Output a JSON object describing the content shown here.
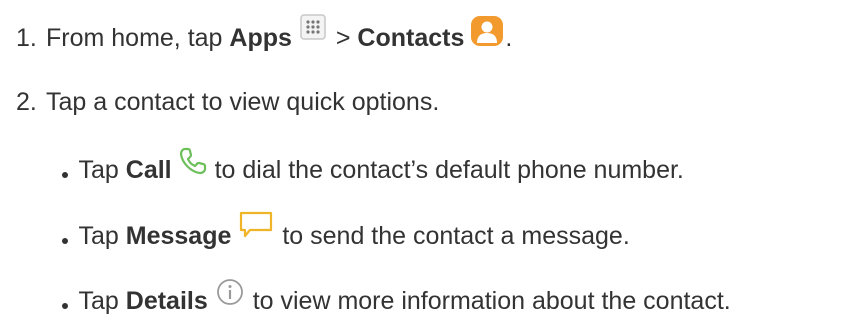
{
  "steps": [
    {
      "number": "1.",
      "pre": "From home, tap ",
      "bold1": "Apps",
      "mid": " > ",
      "bold2": "Contacts",
      "post": ".",
      "icon1": "apps-grid-icon",
      "icon2": "contacts-app-icon"
    },
    {
      "number": "2.",
      "text": "Tap a contact to view quick options."
    }
  ],
  "bullets": [
    {
      "pre": "Tap ",
      "bold": "Call",
      "post": " to dial the contact’s default phone number.",
      "icon": "phone-call-icon",
      "icon_color": "#6cbf5a"
    },
    {
      "pre": "Tap ",
      "bold": "Message",
      "post": " to send the contact a message.",
      "icon": "message-bubble-icon",
      "icon_color": "#f0b429"
    },
    {
      "pre": "Tap ",
      "bold": "Details",
      "post": " to view more information about the contact.",
      "icon": "info-circle-icon",
      "icon_color": "#9a9a9a"
    }
  ],
  "colors": {
    "text": "#333333",
    "contacts_icon": "#f29a2e"
  }
}
